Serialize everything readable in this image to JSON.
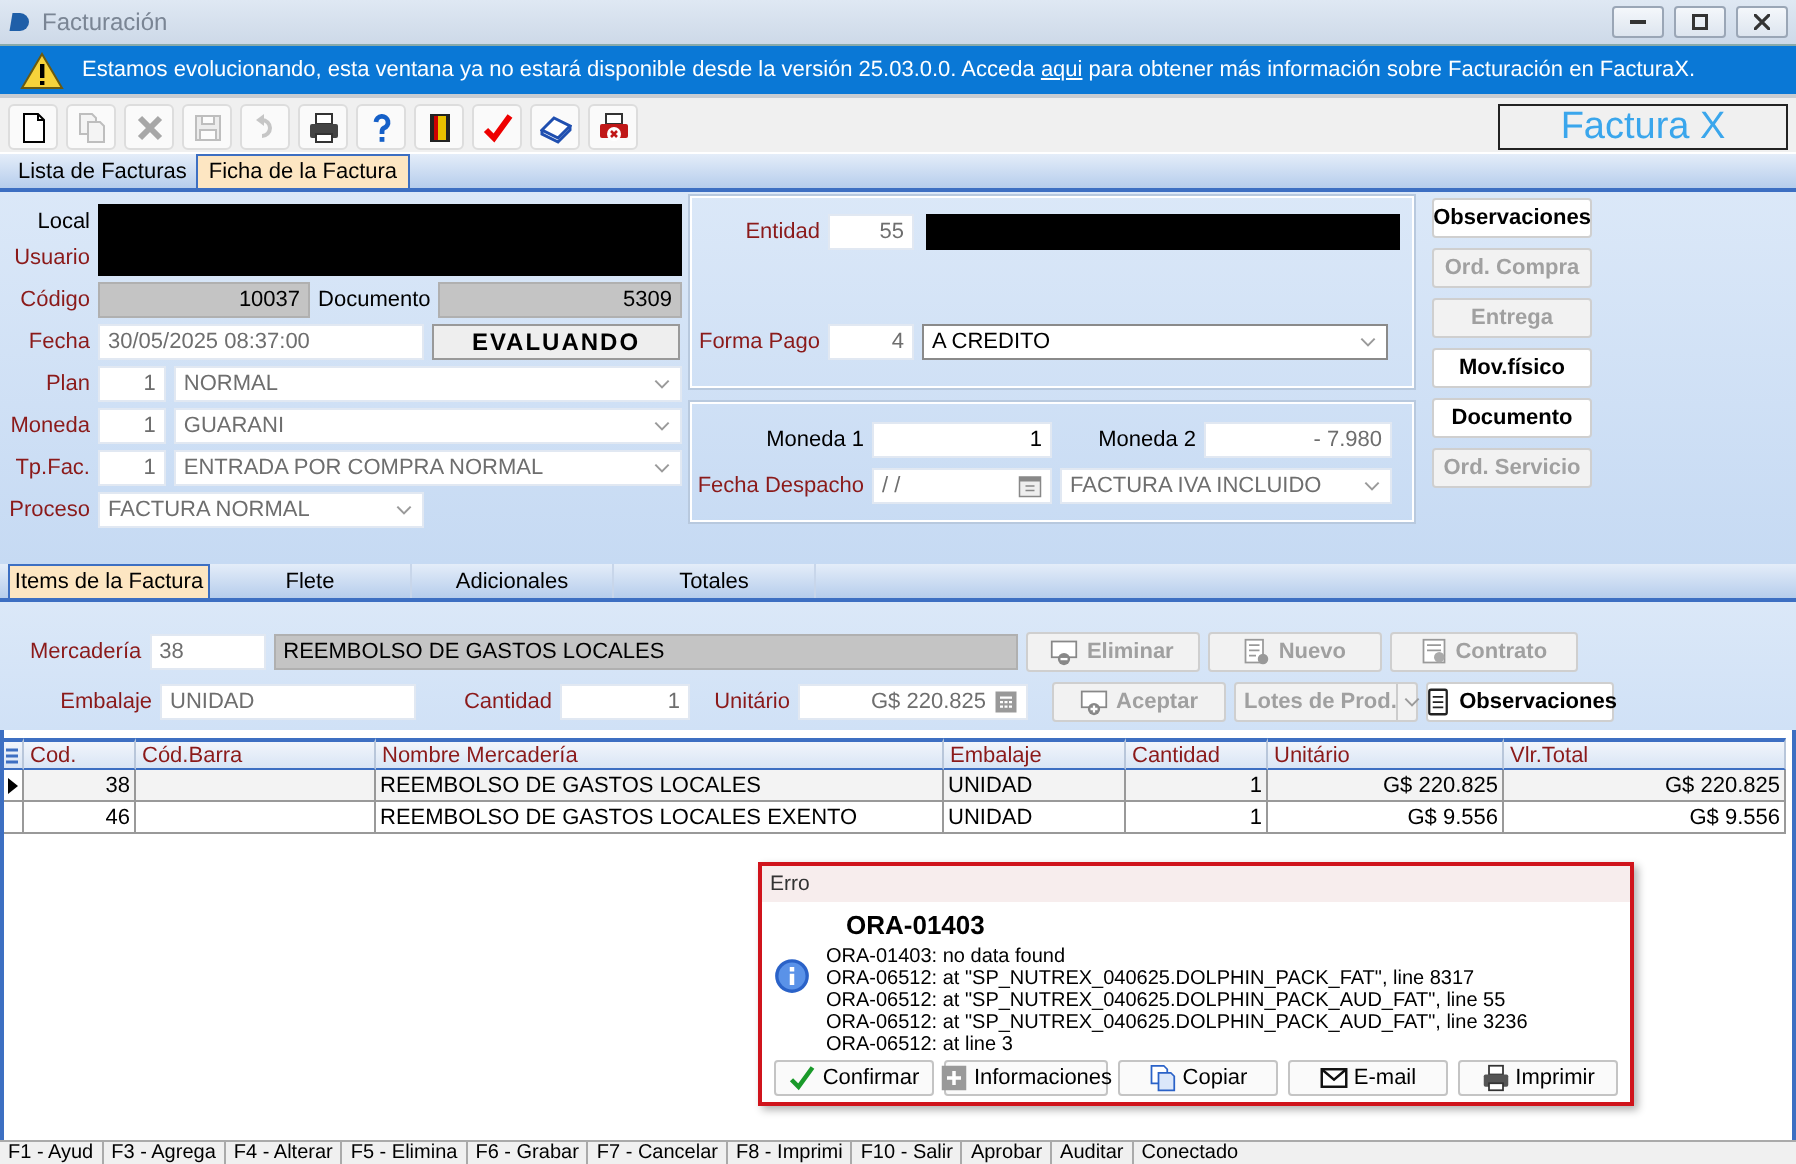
{
  "window": {
    "title": "Facturación"
  },
  "banner": {
    "text_before": "Estamos evolucionando, esta ventana ya no estará disponible desde la versión 25.03.0.0. Acceda ",
    "link": "aqui",
    "text_after": " para obtener más información sobre Facturación en FacturaX."
  },
  "toolbar": {
    "buttons": [
      {
        "kind": "new",
        "disabled": false
      },
      {
        "kind": "copy",
        "disabled": true
      },
      {
        "kind": "delete",
        "disabled": true
      },
      {
        "kind": "save",
        "disabled": true
      },
      {
        "kind": "undo",
        "disabled": true
      },
      {
        "kind": "print",
        "disabled": false
      },
      {
        "kind": "help",
        "disabled": false
      },
      {
        "kind": "exit",
        "disabled": false
      },
      {
        "kind": "confirm",
        "disabled": false
      },
      {
        "kind": "book",
        "disabled": false
      },
      {
        "kind": "print_cancel",
        "disabled": false
      }
    ],
    "brand": "Factura X"
  },
  "tabs": [
    {
      "label": "Lista de Facturas",
      "selected": false
    },
    {
      "label": "Ficha de la Factura",
      "selected": true
    }
  ],
  "header": {
    "local": {
      "label": "Local",
      "required": false
    },
    "usuario": {
      "label": "Usuario",
      "required": true
    },
    "codigo": {
      "label": "Código",
      "required": true,
      "value": "10037"
    },
    "documento": {
      "label": "Documento",
      "required": false,
      "value": "5309"
    },
    "fecha": {
      "label": "Fecha",
      "required": true,
      "value": "30/05/2025 08:37:00"
    },
    "status": "EVALUANDO",
    "plan": {
      "label": "Plan",
      "required": true,
      "code": "1",
      "value": "NORMAL",
      "disabled": true
    },
    "moneda": {
      "label": "Moneda",
      "required": true,
      "code": "1",
      "value": "GUARANI",
      "disabled": true
    },
    "tipo": {
      "label": "Tp.Fac.",
      "required": true,
      "code": "1",
      "value": "ENTRADA POR COMPRA NORMAL",
      "disabled": true
    },
    "proceso": {
      "label": "Proceso",
      "required": true,
      "value": "FACTURA NORMAL",
      "disabled": true
    },
    "entidad": {
      "label": "Entidad",
      "required": true,
      "code": "55"
    },
    "forma_pago": {
      "label": "Forma Pago",
      "required": true,
      "code": "4",
      "value": "A CREDITO",
      "disabled": false
    },
    "moneda_1": {
      "label": "Moneda 1",
      "required": false,
      "value": "1"
    },
    "moneda_2": {
      "label": "Moneda 2",
      "required": false,
      "value": "- 7.980"
    },
    "fecha_despacho": {
      "label": "Fecha Despacho",
      "required": true,
      "value": "/  /"
    },
    "iva": {
      "value": "FACTURA IVA INCLUIDO",
      "disabled": true
    }
  },
  "side_buttons": [
    {
      "label": "Observaciones",
      "disabled": false
    },
    {
      "label": "Ord. Compra",
      "disabled": true
    },
    {
      "label": "Entrega",
      "disabled": true
    },
    {
      "label": "Mov.físico",
      "disabled": false
    },
    {
      "label": "Documento",
      "disabled": false
    },
    {
      "label": "Ord. Servicio",
      "disabled": true
    }
  ],
  "item_tabs": [
    {
      "label": "Items de la Factura",
      "selected": true
    },
    {
      "label": "Flete",
      "selected": false
    },
    {
      "label": "Adicionales",
      "selected": false
    },
    {
      "label": "Totales",
      "selected": false
    }
  ],
  "item_form": {
    "mercaderia": {
      "label": "Mercadería",
      "required": true,
      "code": "38",
      "value": "REEMBOLSO DE GASTOS LOCALES"
    },
    "embalaje": {
      "label": "Embalaje",
      "required": true,
      "value": "UNIDAD"
    },
    "cantidad": {
      "label": "Cantidad",
      "required": true,
      "value": "1"
    },
    "unitario": {
      "label": "Unitário",
      "required": true,
      "value": "G$ 220.825"
    }
  },
  "item_buttons": [
    {
      "label": "Eliminar",
      "kind": "remove",
      "disabled": true
    },
    {
      "label": "Nuevo",
      "kind": "new",
      "disabled": true
    },
    {
      "label": "Contrato",
      "kind": "contract",
      "disabled": true
    },
    {
      "label": "Aceptar",
      "kind": "accept",
      "disabled": true
    },
    {
      "label": "Lotes de Prod.",
      "kind": "dropdown",
      "disabled": true
    },
    {
      "label": "Observaciones",
      "kind": "notes",
      "disabled": false
    }
  ],
  "table": {
    "columns": [
      "Cod.",
      "Cód.Barra",
      "Nombre Mercadería",
      "Embalaje",
      "Cantidad",
      "Unitário",
      "Vlr.Total"
    ],
    "rows": [
      {
        "selected": true,
        "cod": "38",
        "nombre": "REEMBOLSO DE GASTOS LOCALES",
        "embalaje": "UNIDAD",
        "cantidad": "1",
        "unitario": "G$ 220.825",
        "total": "G$ 220.825"
      },
      {
        "selected": false,
        "cod": "46",
        "nombre": "REEMBOLSO DE GASTOS LOCALES EXENTO",
        "embalaje": "UNIDAD",
        "cantidad": "1",
        "unitario": "G$ 9.556",
        "total": "G$ 9.556"
      }
    ]
  },
  "dialog": {
    "title": "Erro",
    "heading": "ORA-01403",
    "lines": [
      "ORA-01403: no data found",
      "ORA-06512: at \"SP_NUTREX_040625.DOLPHIN_PACK_FAT\", line 8317",
      "ORA-06512: at \"SP_NUTREX_040625.DOLPHIN_PACK_AUD_FAT\", line 55",
      "ORA-06512: at \"SP_NUTREX_040625.DOLPHIN_PACK_AUD_FAT\", line 3236",
      "ORA-06512: at line 3"
    ],
    "buttons": [
      {
        "label": "Confirmar",
        "kind": "confirm"
      },
      {
        "label": "Informaciones",
        "kind": "info"
      },
      {
        "label": "Copiar",
        "kind": "copy"
      },
      {
        "label": "E-mail",
        "kind": "email"
      },
      {
        "label": "Imprimir",
        "kind": "print"
      }
    ]
  },
  "status_bar": [
    "F1 - Ayud",
    "F3 - Agrega",
    "F4 - Alterar",
    "F5 - Elimina",
    "F6 - Grabar",
    "F7 - Cancelar",
    "F8 - Imprimi",
    "F10 - Salir",
    "Aprobar",
    "Auditar",
    "Conectado"
  ]
}
